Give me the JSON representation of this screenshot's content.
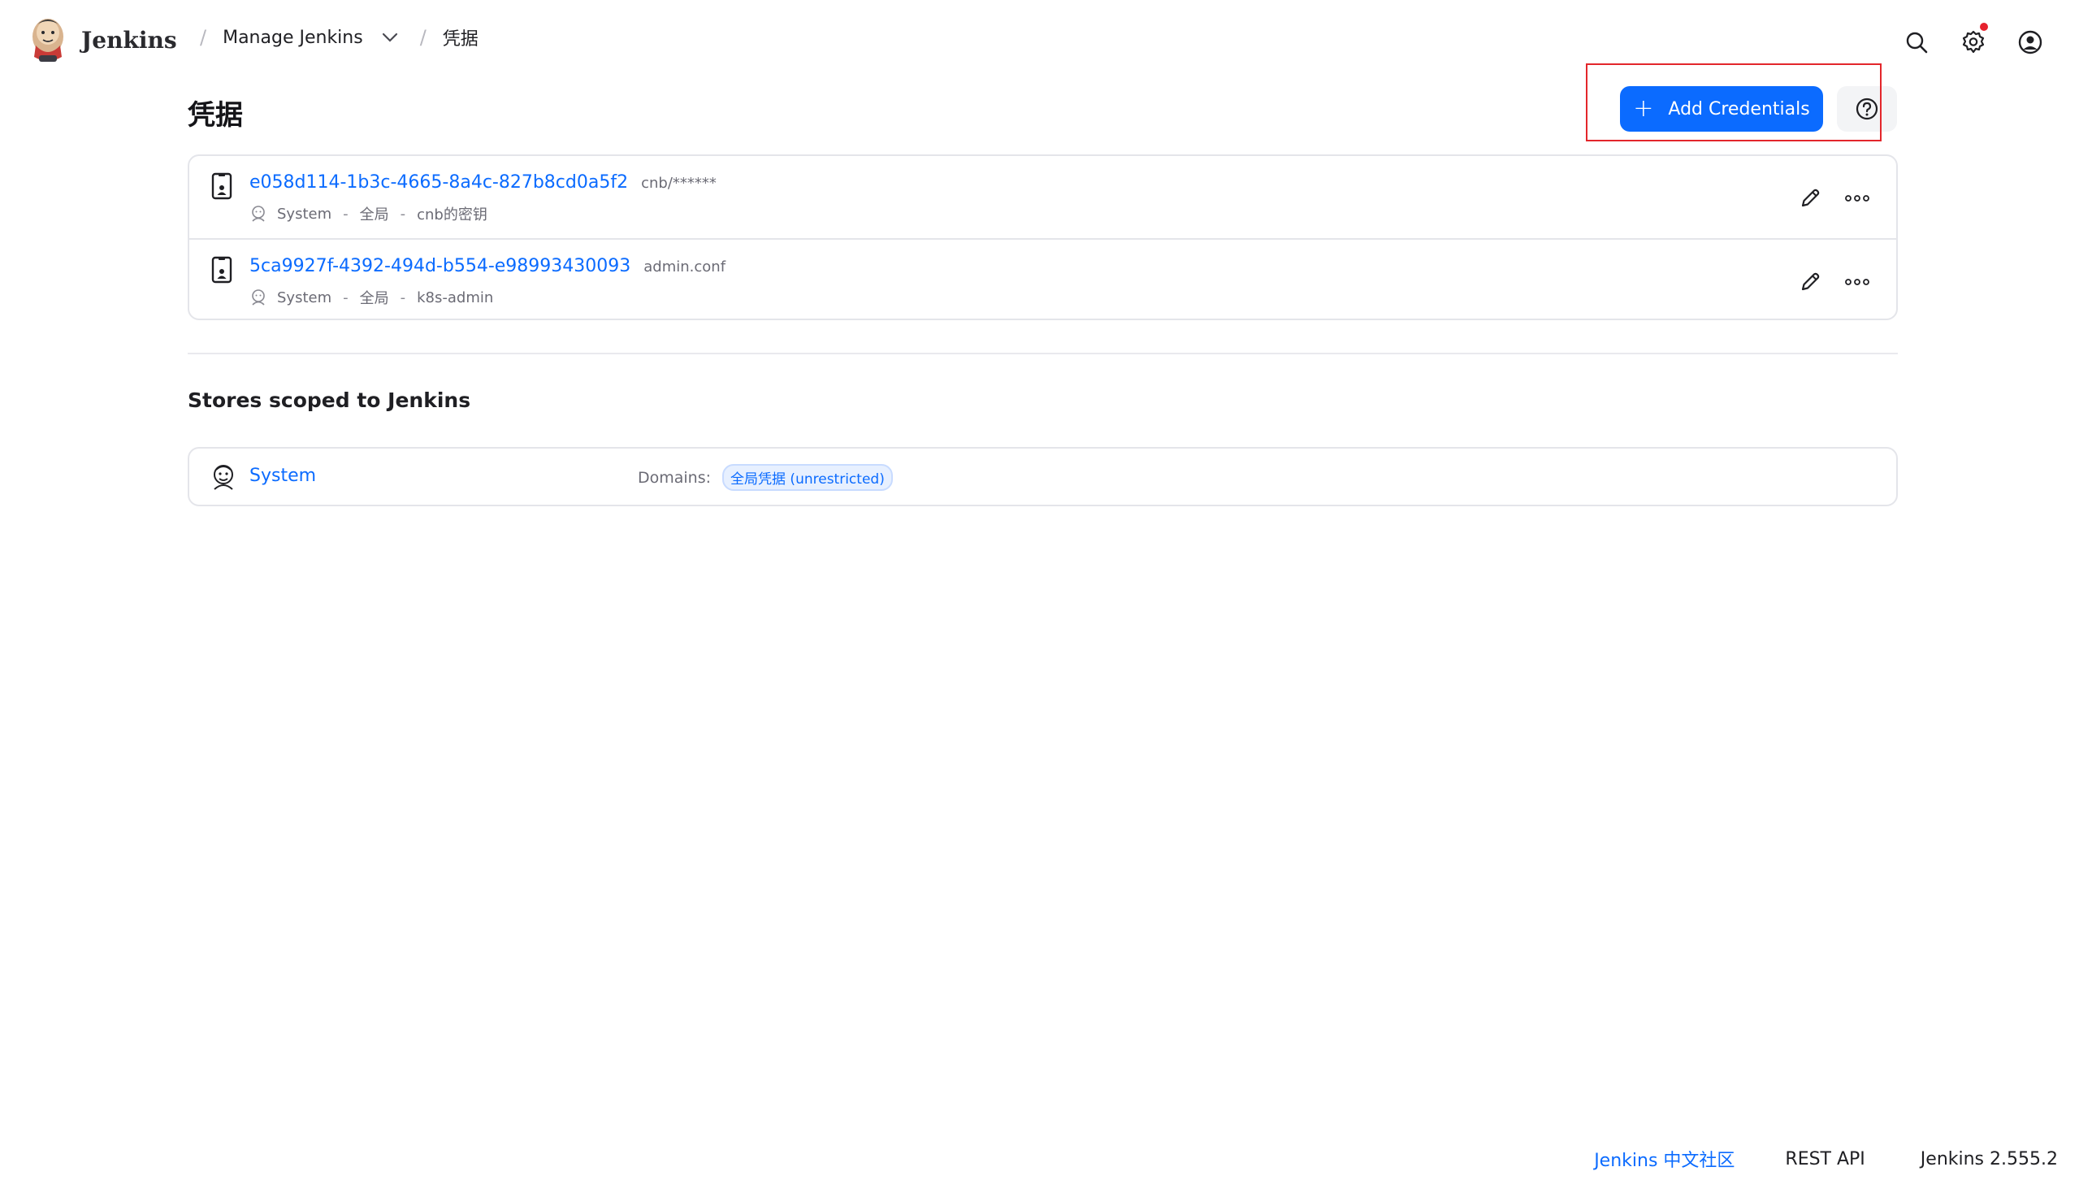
{
  "header": {
    "app_name": "Jenkins",
    "breadcrumbs": [
      {
        "label": "Manage Jenkins"
      },
      {
        "label": "凭据"
      }
    ]
  },
  "page": {
    "title": "凭据",
    "add_button_label": "Add Credentials"
  },
  "credentials": [
    {
      "id": "e058d114-1b3c-4665-8a4c-827b8cd0a5f2",
      "description": "cnb/******",
      "store": "System",
      "domain": "全局",
      "name": "cnb的密钥"
    },
    {
      "id": "5ca9927f-4392-494d-b554-e98993430093",
      "description": "admin.conf",
      "store": "System",
      "domain": "全局",
      "name": "k8s-admin"
    }
  ],
  "stores": {
    "section_title": "Stores scoped to Jenkins",
    "items": [
      {
        "name": "System",
        "domains_label": "Domains:",
        "domain_badge": "全局凭据 (unrestricted)"
      }
    ]
  },
  "footer": {
    "community_link": "Jenkins 中文社区",
    "rest_api": "REST API",
    "version": "Jenkins 2.555.2"
  },
  "colors": {
    "accent": "#0b6bff",
    "highlight": "#e3262b",
    "notify_dot": "#e6222e"
  },
  "icons": {
    "search": "search-icon",
    "settings": "gear-icon",
    "account": "user-circle-icon",
    "credential": "id-card-icon",
    "edit": "pencil-icon",
    "more": "ellipsis-icon",
    "help": "help-circle-icon"
  }
}
